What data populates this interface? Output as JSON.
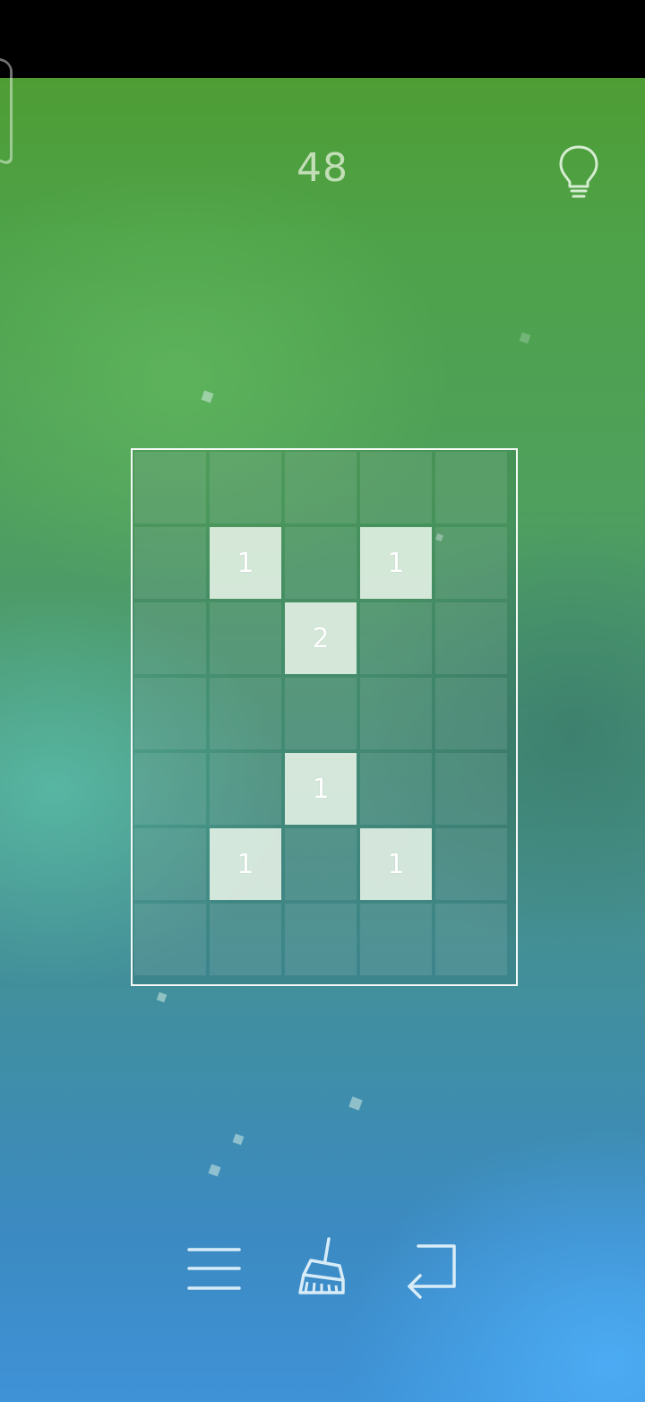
{
  "header": {
    "move_count": "48",
    "hint_icon": "lightbulb-icon"
  },
  "board": {
    "columns": 5,
    "rows": 7,
    "cells": [
      [
        "",
        "",
        "",
        "",
        ""
      ],
      [
        "",
        "1",
        "",
        "1",
        ""
      ],
      [
        "",
        "",
        "2",
        "",
        ""
      ],
      [
        "",
        "",
        "",
        "",
        ""
      ],
      [
        "",
        "",
        "1",
        "",
        ""
      ],
      [
        "",
        "1",
        "",
        "1",
        ""
      ],
      [
        "",
        "",
        "",
        "",
        ""
      ]
    ]
  },
  "toolbar": {
    "menu_icon": "menu-icon",
    "clear_icon": "broom-icon",
    "back_icon": "return-arrow-icon"
  },
  "colors": {
    "top_background": "#4e9a2a",
    "bottom_background": "#3e92d6",
    "filled_cell": "#e8f4e8",
    "icon_color": "#d8ecf8"
  }
}
